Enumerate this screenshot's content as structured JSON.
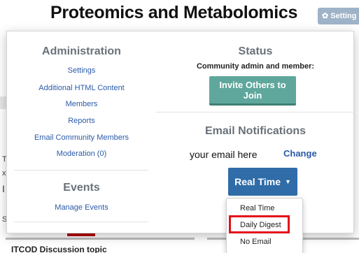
{
  "page": {
    "title": "Proteomics and Metabolomics",
    "settings_button": "Setting"
  },
  "background": {
    "bottom_text": "ITCOD Discussion topic"
  },
  "admin": {
    "heading": "Administration",
    "links": [
      "Settings",
      "Additional HTML Content",
      "Members",
      "Reports",
      "Email Community Members",
      "Moderation (0)"
    ]
  },
  "events": {
    "heading": "Events",
    "link": "Manage Events"
  },
  "status": {
    "heading": "Status",
    "role_text": "Community admin and member:",
    "invite_button": "Invite Others to Join"
  },
  "email_notifications": {
    "heading": "Email Notifications",
    "email_value": "your email here",
    "change_link": "Change",
    "frequency_button": "Real Time",
    "options": [
      "Real Time",
      "Daily Digest",
      "No Email"
    ],
    "highlighted_option": "Daily Digest"
  },
  "colors": {
    "invite_button": "#5fa79c",
    "frequency_button": "#2f6ca8",
    "link": "#2a5aa8",
    "highlight": "#e3101a"
  }
}
